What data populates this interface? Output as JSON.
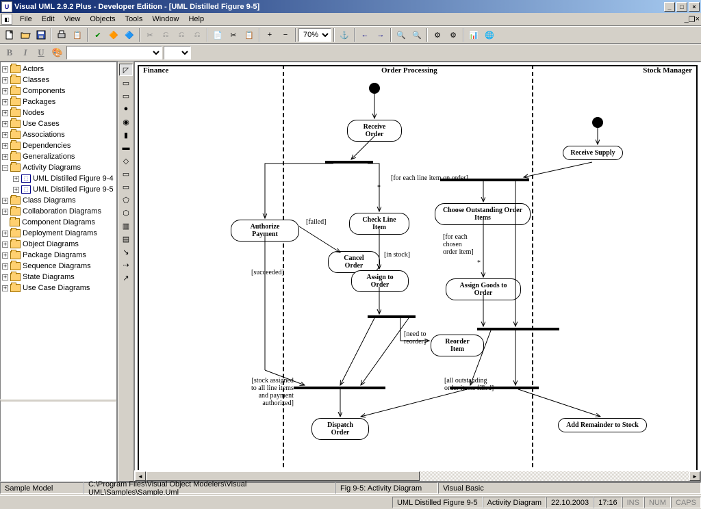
{
  "title": "Visual UML 2.9.2 Plus - Developer Edition - [UML Distilled Figure 9-5]",
  "menu": [
    "File",
    "Edit",
    "View",
    "Objects",
    "Tools",
    "Window",
    "Help"
  ],
  "zoom": "70%",
  "tree": {
    "items": [
      {
        "label": "Actors",
        "exp": "+"
      },
      {
        "label": "Classes",
        "exp": "+"
      },
      {
        "label": "Components",
        "exp": "+"
      },
      {
        "label": "Packages",
        "exp": "+"
      },
      {
        "label": "Nodes",
        "exp": "+"
      },
      {
        "label": "Use Cases",
        "exp": "+"
      },
      {
        "label": "Associations",
        "exp": "+"
      },
      {
        "label": "Dependencies",
        "exp": "+"
      },
      {
        "label": "Generalizations",
        "exp": "+"
      },
      {
        "label": "Activity Diagrams",
        "exp": "−"
      },
      {
        "label": "UML Distilled Figure 9-4",
        "exp": "+",
        "indent": 1,
        "icon": "diag"
      },
      {
        "label": "UML Distilled Figure 9-5",
        "exp": "+",
        "indent": 1,
        "icon": "diag"
      },
      {
        "label": "Class Diagrams",
        "exp": "+"
      },
      {
        "label": "Collaboration Diagrams",
        "exp": "+"
      },
      {
        "label": "Component Diagrams",
        "exp": ""
      },
      {
        "label": "Deployment Diagrams",
        "exp": "+"
      },
      {
        "label": "Object Diagrams",
        "exp": "+"
      },
      {
        "label": "Package Diagrams",
        "exp": "+"
      },
      {
        "label": "Sequence Diagrams",
        "exp": "+"
      },
      {
        "label": "State Diagrams",
        "exp": "+"
      },
      {
        "label": "Use Case Diagrams",
        "exp": "+"
      }
    ]
  },
  "lanes": {
    "l1": "Finance",
    "l2": "Order Processing",
    "l3": "Stock Manager"
  },
  "activities": {
    "receive_order": "Receive Order",
    "receive_supply": "Receive Supply",
    "authorize_payment": "Authorize Payment",
    "check_line": "Check Line Item",
    "choose_outstanding": "Choose Outstanding Order Items",
    "cancel": "Cancel Order",
    "assign_order": "Assign to Order",
    "assign_goods": "Assign Goods to Order",
    "reorder": "Reorder Item",
    "dispatch": "Dispatch Order",
    "add_remainder": "Add Remainder to Stock"
  },
  "guards": {
    "for_each_line": "[for each line item on order]",
    "star1": "*",
    "failed": "[failed]",
    "succeeded": "[succeeded]",
    "in_stock": "[in stock]",
    "for_each_chosen": "[for each\nchosen\norder item]",
    "star2": "*",
    "need_reorder": "[need to\nreorder]",
    "stock_assigned": "[stock assigned\nto all line items\nand payment\nauthorized]",
    "all_filled": "[all outstanding\norder items filled]"
  },
  "status1": {
    "model": "Sample Model",
    "path": "C:\\Program Files\\Visual Object Modelers\\Visual UML\\Samples\\Sample.Uml",
    "fig": "Fig 9-5: Activity Diagram",
    "lang": "Visual Basic"
  },
  "status2": {
    "doc": "UML Distilled Figure 9-5",
    "type": "Activity Diagram",
    "date": "22.10.2003",
    "time": "17:16",
    "ins": "INS",
    "num": "NUM",
    "caps": "CAPS"
  }
}
